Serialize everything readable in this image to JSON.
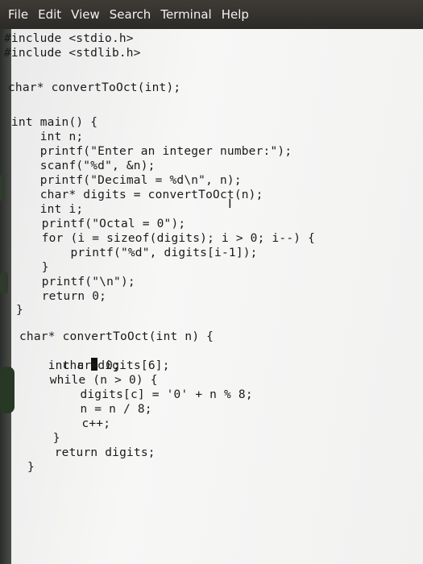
{
  "menubar": {
    "file": "File",
    "edit": "Edit",
    "view": "View",
    "search": "Search",
    "terminal": "Terminal",
    "help": "Help"
  },
  "code": {
    "l1": "#include <stdio.h>",
    "l2": "#include <stdlib.h>",
    "l3": "char* convertToOct(int);",
    "l4": "int main() {",
    "l5": "    int n;",
    "l6": "    printf(\"Enter an integer number:\");",
    "l7": "    scanf(\"%d\", &n);",
    "l8": "    printf(\"Decimal = %d\\n\", n);",
    "l9": "    char* digits = convertToOct(n);",
    "l10": "    int i;",
    "l11": "    printf(\"Octal = 0\");",
    "l12": "    for (i = sizeof(digits); i > 0; i--) {",
    "l13": "        printf(\"%d\", digits[i-1]);",
    "l14": "    }",
    "l15": "    printf(\"\\n\");",
    "l16": "    return 0;",
    "l17": "}",
    "l18": "char* convertToOct(int n) {",
    "l19a": "    char",
    "l19b": "digits[6];",
    "l20": "    int c = 0;",
    "l21": "    while (n > 0) {",
    "l22": "        digits[c] = '0' + n % 8;",
    "l23": "        n = n / 8;",
    "l24": "        c++;",
    "l25": "    }",
    "l26": "    return digits;",
    "l27": "}"
  }
}
